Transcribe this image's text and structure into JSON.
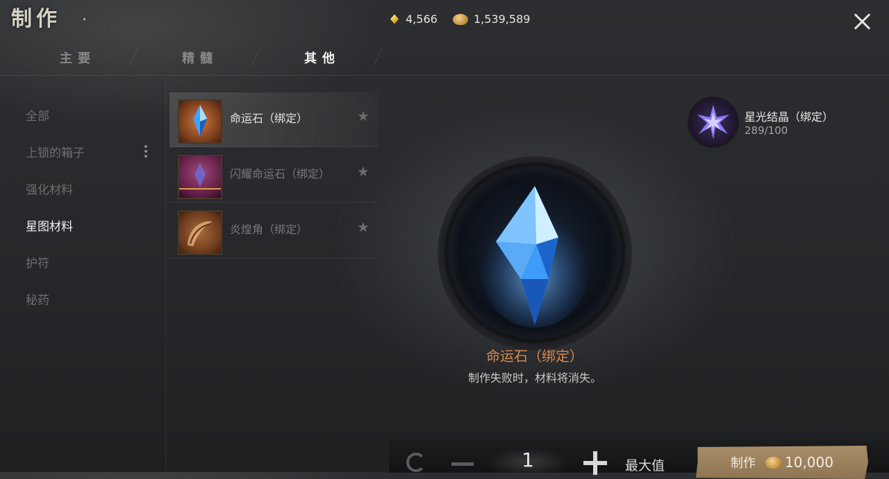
{
  "header": {
    "title": "制作",
    "currency": {
      "gems": "4,566",
      "gold": "1,539,589"
    }
  },
  "tabs": [
    {
      "label": "主要",
      "active": false
    },
    {
      "label": "精髓",
      "active": false
    },
    {
      "label": "其他",
      "active": true
    }
  ],
  "categories": [
    {
      "label": "全部",
      "active": false
    },
    {
      "label": "上锁的箱子",
      "active": false
    },
    {
      "label": "强化材料",
      "active": false
    },
    {
      "label": "星图材料",
      "active": true
    },
    {
      "label": "护符",
      "active": false
    },
    {
      "label": "秘药",
      "active": false
    }
  ],
  "items": [
    {
      "name": "命运石（绑定）",
      "selected": true,
      "available": true,
      "icon": "blue-crystal-icon"
    },
    {
      "name": "闪耀命运石（绑定）",
      "selected": false,
      "available": false,
      "icon": "purple-crystal-icon"
    },
    {
      "name": "炎煌角（绑定）",
      "selected": false,
      "available": false,
      "icon": "horn-icon"
    }
  ],
  "requirement": {
    "name": "星光结晶（绑定）",
    "count": "289/100",
    "icon": "star-crystal-icon"
  },
  "selected": {
    "name": "命运石（绑定）",
    "description": "制作失败时，材料将消失。"
  },
  "footer": {
    "quantity": "1",
    "max_label": "最大值",
    "craft_label": "制作",
    "craft_cost": "10,000"
  },
  "colors": {
    "accent_orange": "#d98a4a",
    "craft_button": "#9c8260",
    "background": "#2a2c2f"
  }
}
